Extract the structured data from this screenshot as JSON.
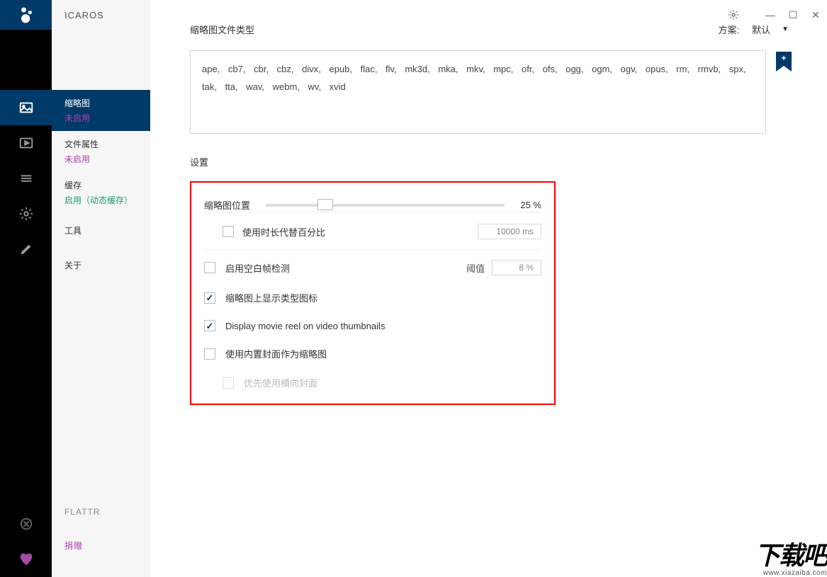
{
  "app": {
    "title": "ICAROS"
  },
  "sidebar": {
    "items": [
      {
        "label": "缩略图",
        "status": "未启用"
      },
      {
        "label": "文件属性",
        "status": "未启用"
      },
      {
        "label": "缓存",
        "status": "启用（动态缓存）"
      },
      {
        "label": "工具"
      },
      {
        "label": "关于"
      }
    ],
    "flattr": "FLATTR",
    "donate": "捐赠"
  },
  "main": {
    "filetypes_title": "缩略图文件类型",
    "scheme_label": "方案:",
    "scheme_value": "默认",
    "filetypes_text": "ape, cb7, cbr, cbz, divx, epub, flac, flv, mk3d, mka, mkv, mpc, ofr, ofs, ogg, ogm, ogv, opus, rm, rmvb, spx, tak, tta, wav, webm, wv, xvid",
    "settings_title": "设置",
    "slider": {
      "label": "缩略图位置",
      "value": "25 %"
    },
    "duration": {
      "label": "使用时长代替百分比",
      "value": "10000 ms"
    },
    "blank": {
      "label": "启用空白帧检测",
      "threshold_label": "阈值",
      "threshold_value": "8 %"
    },
    "overlay": {
      "label": "缩略图上显示类型图标"
    },
    "reel": {
      "label": "Display movie reel on video thumbnails"
    },
    "cover": {
      "label": "使用内置封面作为缩略图"
    },
    "landscape": {
      "label": "优先使用横向封面"
    }
  },
  "watermark": {
    "text": "下载吧",
    "url": "www.xiazaiba.com"
  }
}
